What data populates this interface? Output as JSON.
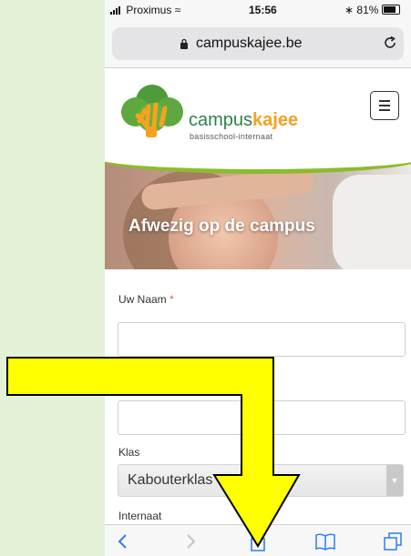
{
  "status_bar": {
    "carrier": "Proximus",
    "time": "15:56",
    "battery": "81%",
    "battery_level": 0.81
  },
  "url_bar": {
    "domain": "campuskajee.be"
  },
  "site": {
    "brand_prefix": "campus",
    "brand_suffix": "kajee",
    "tagline": "basisschool-internaat",
    "hero_title": "Afwezig op de campus"
  },
  "form": {
    "name_label": "Uw Naam",
    "required_mark": "*",
    "name_value": "",
    "second_value": "",
    "klas_label": "Klas",
    "klas_value": "Kabouterklas",
    "internaat_label": "Internaat"
  },
  "colors": {
    "brand_green": "#2f7f4a",
    "brand_orange": "#f5a21c",
    "arrow_yellow": "#ffff00",
    "page_bg": "#e3f2d7"
  },
  "icons": [
    "lock-icon",
    "reload-icon",
    "menu-icon",
    "back-icon",
    "forward-icon",
    "share-icon",
    "bookmarks-icon",
    "tabs-icon"
  ]
}
